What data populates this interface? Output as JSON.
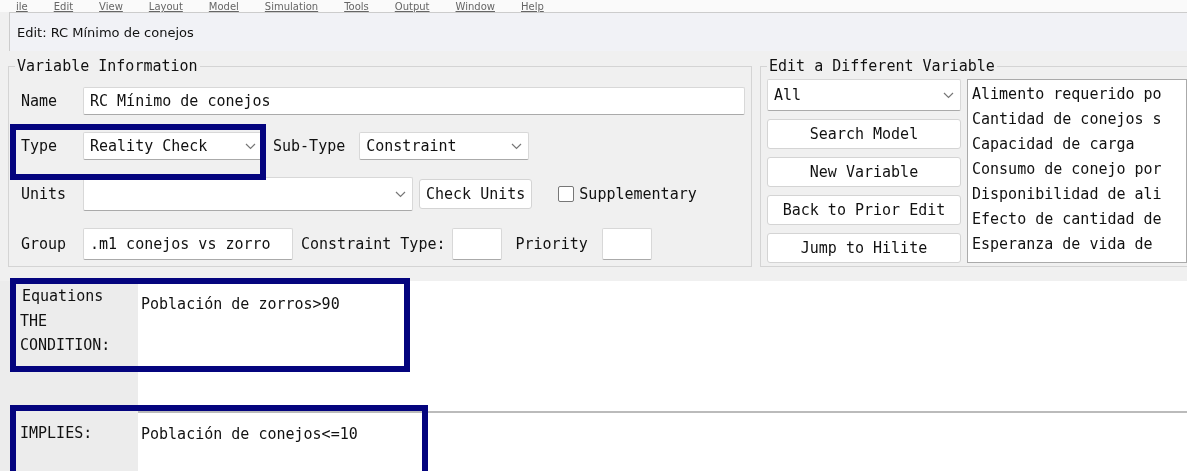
{
  "menu_bar": [
    "ile",
    "Edit",
    "View",
    "Layout",
    "Model",
    "Simulation",
    "Tools",
    "Output",
    "Window",
    "Help"
  ],
  "window": {
    "title": "Edit: RC Mínimo de conejos"
  },
  "variable_information": {
    "legend": "Variable Information",
    "name": {
      "label": "Name",
      "value": "RC Mínimo de conejos"
    },
    "type": {
      "label": "Type",
      "value": "Reality Check"
    },
    "sub_type": {
      "label": "Sub-Type",
      "value": "Constraint"
    },
    "units": {
      "label": "Units"
    },
    "check_units_button": "Check Units",
    "supplementary": {
      "label": "Supplementary",
      "checked": false
    },
    "group": {
      "label": "Group",
      "value": ".m1 conejos vs zorro"
    },
    "constraint_type": {
      "label": "Constraint Type:"
    },
    "priority": {
      "label": "Priority"
    }
  },
  "edit_different_variable": {
    "legend": "Edit a Different Variable",
    "filter": "All",
    "buttons": [
      "Search Model",
      "New Variable",
      "Back to Prior Edit",
      "Jump to Hilite"
    ],
    "variables": [
      "Alimento requerido po",
      "Cantidad de conejos s",
      "Capacidad de carga",
      "Consumo de conejo por",
      "Disponibilidad de ali",
      "Efecto de cantidad de",
      "Esperanza de vida de"
    ]
  },
  "equations": {
    "legend": "Equations",
    "condition": {
      "label_lines": [
        "THE",
        "CONDITION:"
      ],
      "value": "Población de zorros>90"
    },
    "implies": {
      "label": "IMPLIES:",
      "value": "Población de conejos<=10"
    }
  }
}
